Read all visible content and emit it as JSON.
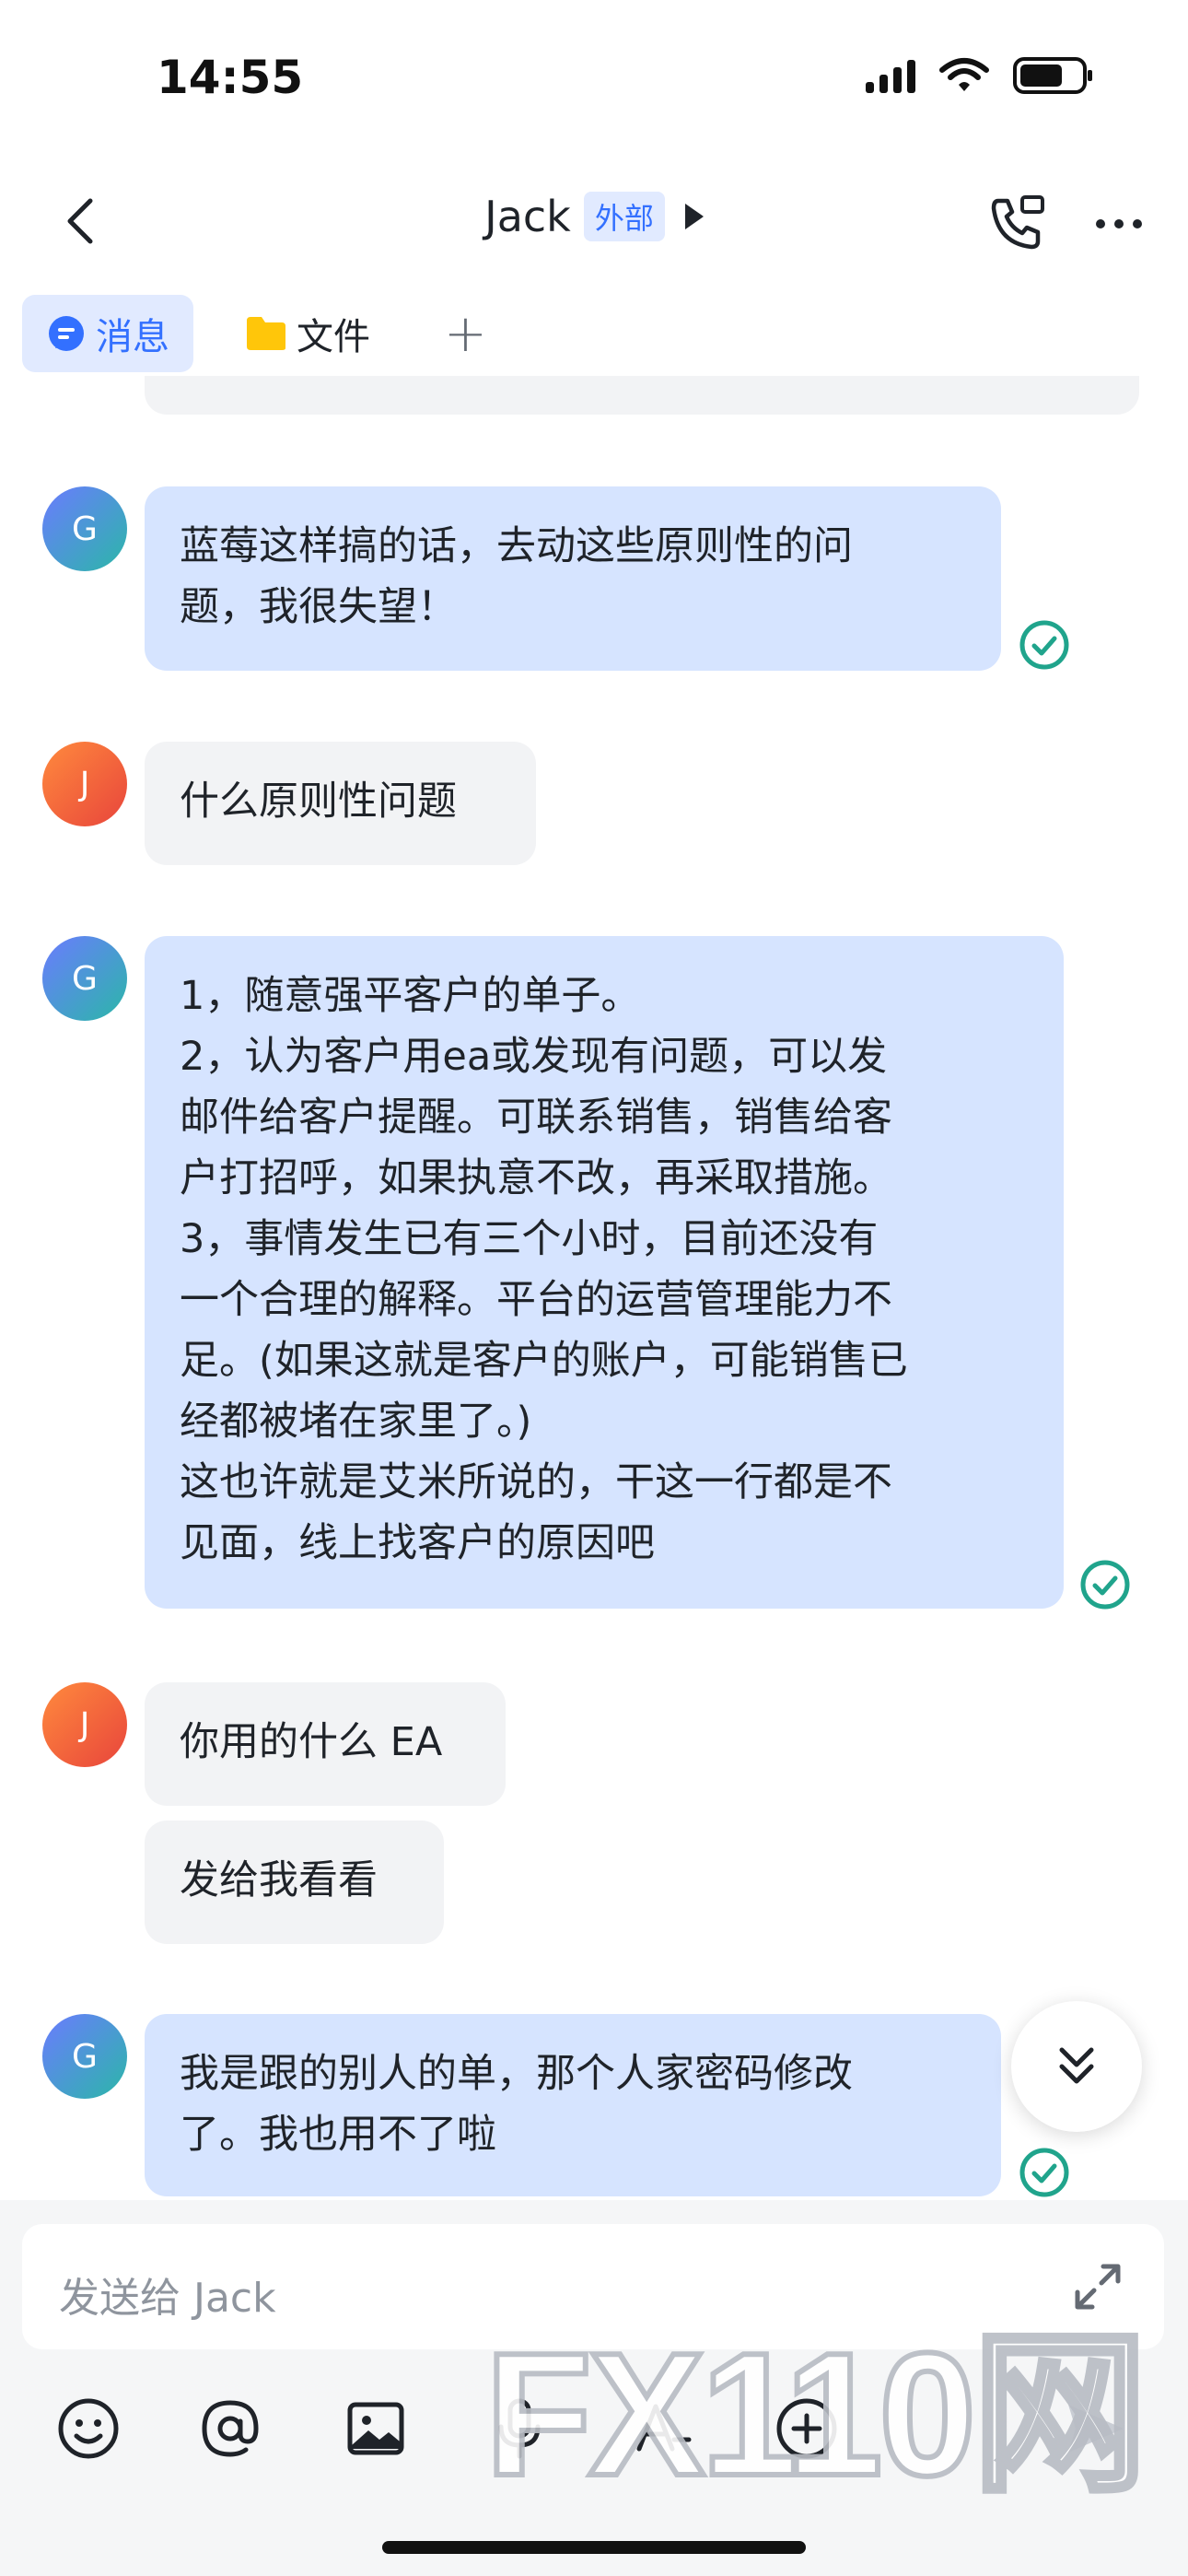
{
  "status_bar": {
    "time": "14:55"
  },
  "header": {
    "title": "Jack",
    "badge": "外部"
  },
  "tabs": [
    {
      "label": "消息",
      "icon": "chat-bubble-icon",
      "active": true
    },
    {
      "label": "文件",
      "icon": "folder-icon",
      "active": false
    }
  ],
  "messages": [
    {
      "sender": "G",
      "from_me": true,
      "read": true,
      "text": "蓝莓这样搞的话，去动这些原则性的问\n题，我很失望！"
    },
    {
      "sender": "J",
      "from_me": false,
      "text": "什么原则性问题"
    },
    {
      "sender": "G",
      "from_me": true,
      "read": true,
      "text": "1，随意强平客户的单子。\n2，认为客户用ea或发现有问题，可以发\n邮件给客户提醒。可联系销售，销售给客\n户打招呼，如果执意不改，再采取措施。\n3，事情发生已有三个小时，目前还没有\n一个合理的解释。平台的运营管理能力不\n足。(如果这就是客户的账户，可能销售已\n经都被堵在家里了。)\n这也许就是艾米所说的，干这一行都是不\n见面，线上找客户的原因吧"
    },
    {
      "sender": "J",
      "from_me": false,
      "text": "你用的什么 EA"
    },
    {
      "sender": "J",
      "from_me": false,
      "text": "发给我看看"
    },
    {
      "sender": "G",
      "from_me": true,
      "read": true,
      "text": "我是跟的别人的单，那个人家密码修改\n了。我也用不了啦"
    }
  ],
  "composer": {
    "placeholder": "发送给 Jack"
  },
  "toolbar": [
    "emoji-icon",
    "mention-icon",
    "image-icon",
    "microphone-icon",
    "text-format-icon",
    "add-icon",
    "send-icon"
  ],
  "watermark": "FX110网",
  "colors": {
    "accent": "#3370ff",
    "my_bubble": "#d6e4ff",
    "their_bubble": "#f2f3f5",
    "read_check": "#20a48c"
  }
}
